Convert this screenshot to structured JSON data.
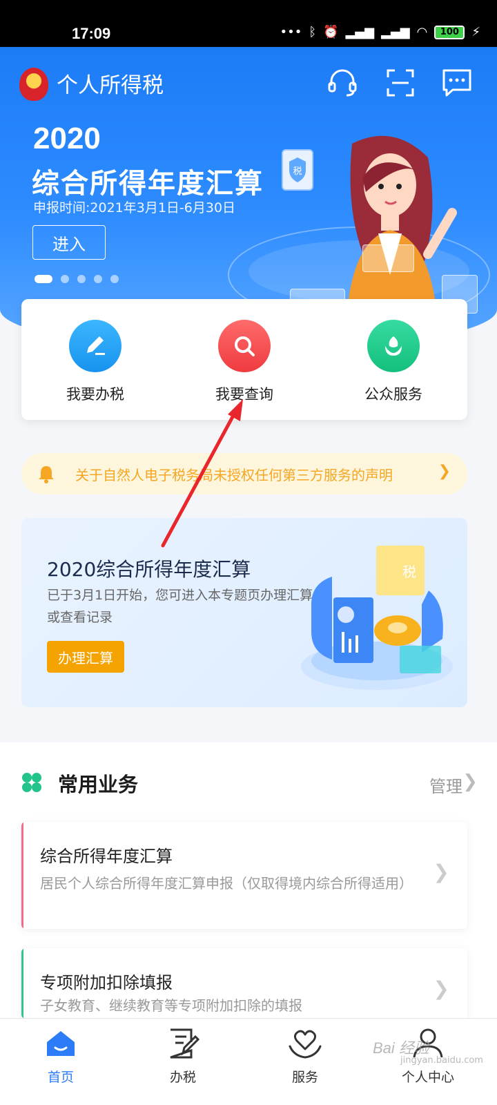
{
  "status_bar": {
    "time": "17:09",
    "battery": "100",
    "icons": [
      "dots-icon",
      "bluetooth-icon",
      "alarm-icon",
      "signal-hd-icon",
      "signal-hd-icon",
      "wifi-icon",
      "battery-icon",
      "charging-icon"
    ]
  },
  "header": {
    "app_title": "个人所得税",
    "icons": [
      "customer-service-icon",
      "scan-icon",
      "message-icon"
    ]
  },
  "banner": {
    "year": "2020",
    "title": "综合所得年度汇算",
    "subtitle": "申报时间:2021年3月1日-6月30日",
    "enter_label": "进入",
    "badge": "税",
    "carousel_count": 5,
    "carousel_active": 1
  },
  "quick_actions": [
    {
      "label": "我要办税",
      "icon": "pen-icon",
      "color": "#1aa3f5"
    },
    {
      "label": "我要查询",
      "icon": "search-icon",
      "color": "#f0474a"
    },
    {
      "label": "公众服务",
      "icon": "tulip-icon",
      "color": "#1ecb8a"
    }
  ],
  "notice": {
    "text": "关于自然人电子税务局未授权任何第三方服务的声明"
  },
  "promo": {
    "title": "2020综合所得年度汇算",
    "desc": "已于3月1日开始，您可进入本专题页办理汇算或查看记录",
    "button": "办理汇算",
    "badge": "税"
  },
  "common_business": {
    "title": "常用业务",
    "manage": "管理",
    "items": [
      {
        "title": "综合所得年度汇算",
        "desc": "居民个人综合所得年度汇算申报（仅取得境内综合所得适用）",
        "accent": "#f06a8a"
      },
      {
        "title": "专项附加扣除填报",
        "desc": "子女教育、继续教育等专项附加扣除的填报",
        "accent": "#2ec98a"
      }
    ]
  },
  "tabbar": [
    {
      "label": "首页",
      "icon": "home-icon",
      "active": true
    },
    {
      "label": "办税",
      "icon": "document-edit-icon",
      "active": false
    },
    {
      "label": "服务",
      "icon": "heart-hand-icon",
      "active": false
    },
    {
      "label": "个人中心",
      "icon": "user-icon",
      "active": false
    }
  ],
  "watermark": {
    "text": "Bai 经验",
    "sub": "jingyan.baidu.com"
  },
  "colors": {
    "brand_blue": "#2b7cf6",
    "notice_orange": "#f5a623",
    "promo_button": "#f5a300",
    "annotation_arrow": "#e8262b"
  }
}
